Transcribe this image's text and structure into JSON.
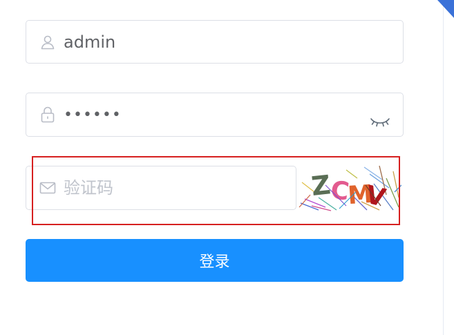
{
  "login_form": {
    "username": {
      "icon": "user-icon",
      "value": "admin"
    },
    "password": {
      "icon": "lock-icon",
      "value": "••••••",
      "toggle_icon": "eye-closed-icon"
    },
    "captcha": {
      "icon": "envelope-icon",
      "placeholder": "验证码",
      "image_text": "ZCMV"
    },
    "submit_label": "登录"
  },
  "colors": {
    "primary": "#1890ff",
    "border": "#dcdfe6",
    "text": "#606266",
    "placeholder": "#c0c4cc",
    "highlight": "#d61f1f"
  }
}
